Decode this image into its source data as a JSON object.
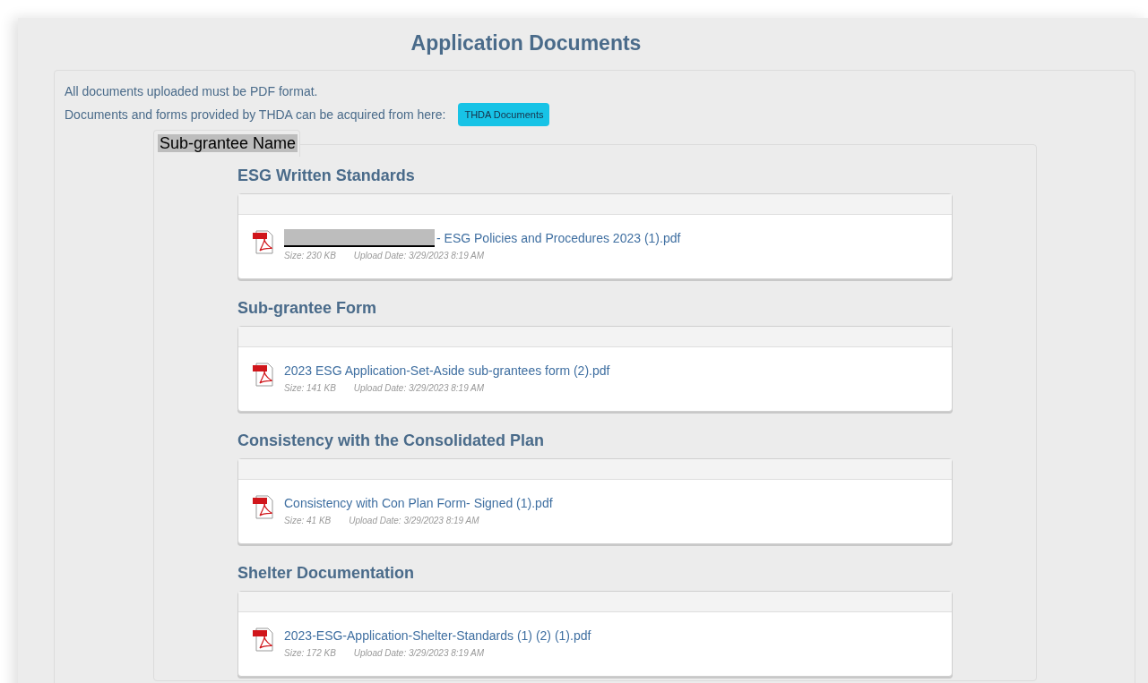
{
  "title": "Application Documents",
  "notes": [
    "All documents uploaded must be PDF format.",
    "Documents and forms provided by THDA can be acquired from here:"
  ],
  "thda_button": "THDA Documents",
  "tab": {
    "label": "Sub-grantee Name",
    "redacted": true
  },
  "sections": [
    {
      "heading": "ESG Written Standards",
      "file": {
        "name": "- ESG Policies and Procedures 2023 (1).pdf",
        "redacted_prefix": true,
        "size": "Size: 230 KB",
        "date": "Upload Date: 3/29/2023 8:19 AM"
      }
    },
    {
      "heading": "Sub-grantee Form",
      "file": {
        "name": "2023 ESG Application-Set-Aside sub-grantees form (2).pdf",
        "redacted_prefix": false,
        "size": "Size: 141 KB",
        "date": "Upload Date: 3/29/2023 8:19 AM"
      }
    },
    {
      "heading": "Consistency with the Consolidated Plan",
      "file": {
        "name": "Consistency with Con Plan Form- Signed (1).pdf",
        "redacted_prefix": false,
        "size": "Size: 41 KB",
        "date": "Upload Date: 3/29/2023 8:19 AM"
      }
    },
    {
      "heading": "Shelter Documentation",
      "file": {
        "name": "2023-ESG-Application-Shelter-Standards (1) (2) (1).pdf",
        "redacted_prefix": false,
        "size": "Size: 172 KB",
        "date": "Upload Date: 3/29/2023 8:19 AM"
      }
    }
  ]
}
